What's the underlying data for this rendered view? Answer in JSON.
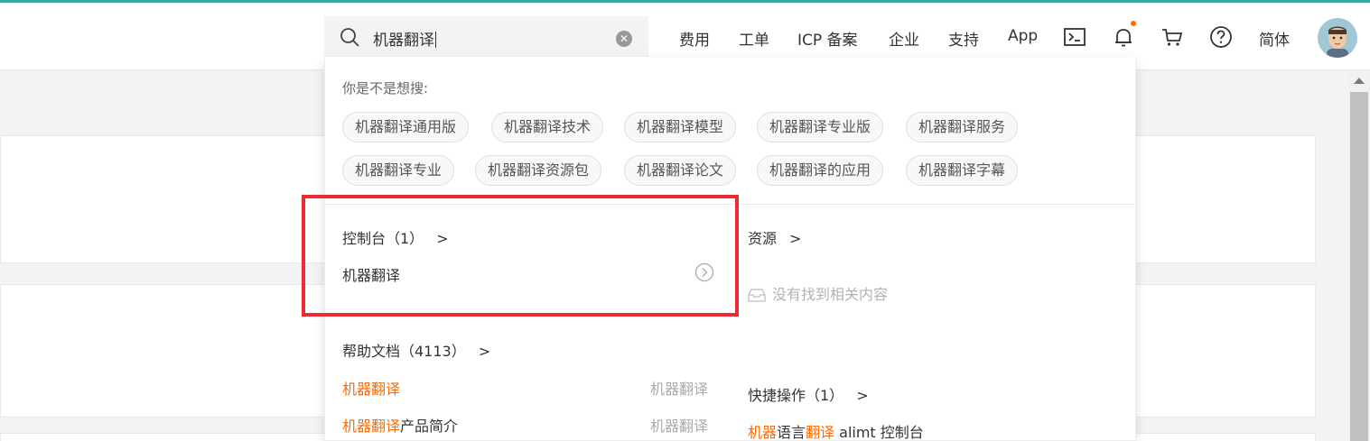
{
  "search": {
    "value": "机器翻译",
    "clear_icon": "clear-circle-icon",
    "icon": "search-icon"
  },
  "nav": {
    "items": [
      "费用",
      "工单",
      "ICP 备案",
      "企业",
      "支持",
      "App"
    ],
    "language": "简体",
    "icons": [
      "terminal-icon",
      "bell-icon",
      "cart-icon",
      "help-icon"
    ]
  },
  "dropdown": {
    "hint": "你是不是想搜:",
    "suggestions": [
      "机器翻译通用版",
      "机器翻译技术",
      "机器翻译模型",
      "机器翻译专业版",
      "机器翻译服务",
      "机器翻译专业",
      "机器翻译资源包",
      "机器翻译论文",
      "机器翻译的应用",
      "机器翻译字幕"
    ],
    "console": {
      "title": "控制台（1）",
      "item": "机器翻译"
    },
    "resources": {
      "title": "资源",
      "empty": "没有找到相关内容"
    },
    "docs": {
      "title": "帮助文档（4113）",
      "items": [
        {
          "highlight": "机器翻译",
          "rest": "",
          "tag": "机器翻译"
        },
        {
          "highlight": "机器翻译",
          "rest": "产品简介",
          "tag": "机器翻译"
        }
      ]
    },
    "quick": {
      "title": "快捷操作（1）",
      "item_parts": [
        {
          "text": "机器",
          "hl": true
        },
        {
          "text": "语言",
          "hl": false
        },
        {
          "text": "翻译",
          "hl": true
        },
        {
          "text": " alimt 控制台",
          "hl": false
        }
      ]
    }
  },
  "colors": {
    "accent": "#37a5a5",
    "highlight": "#ff6a00",
    "annotation_box": "#ea2d33"
  }
}
